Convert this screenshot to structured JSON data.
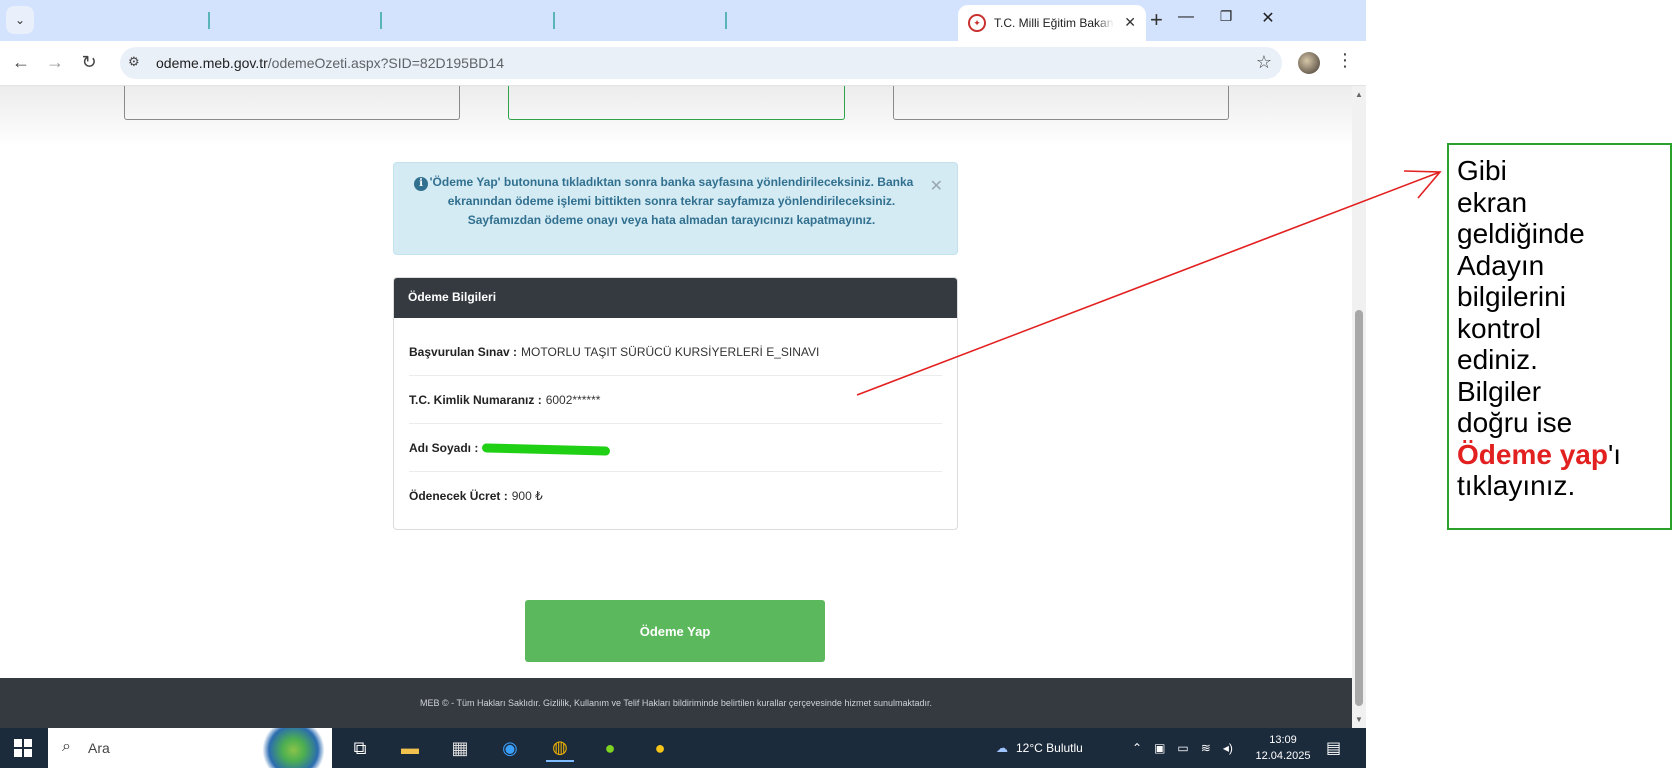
{
  "browser": {
    "tab": {
      "title": "T.C. Milli Eğitim Bakanlığı"
    },
    "url": {
      "host": "odeme.meb.gov.tr",
      "path": "/odemeOzeti.aspx?SID=82D195BD14"
    }
  },
  "page": {
    "info_alert": "'Ödeme Yap' butonuna tıkladıktan sonra banka sayfasına yönlendirileceksiniz. Banka ekranından ödeme işlemi bittikten sonra tekrar sayfamıza yönlendirileceksiniz. Sayfamızdan ödeme onayı veya hata almadan tarayıcınızı kapatmayınız.",
    "panel": {
      "title": "Ödeme Bilgileri",
      "rows": [
        {
          "label": "Başvurulan Sınav :",
          "value": "MOTORLU TAŞIT SÜRÜCÜ KURSİYERLERİ E_SINAVI"
        },
        {
          "label": "T.C. Kimlik Numaranız :",
          "value": "6002******"
        },
        {
          "label": "Adı Soyadı :",
          "value": ""
        },
        {
          "label": "Ödenecek Ücret :",
          "value": "900 ₺"
        }
      ]
    },
    "pay_button": "Ödeme Yap",
    "footer": "MEB © - Tüm Hakları Saklıdır. Gizlilik, Kullanım ve Telif Hakları bildiriminde belirtilen kurallar çerçevesinde hizmet sunulmaktadır."
  },
  "taskbar": {
    "search_placeholder": "Ara",
    "weather": "12°C  Bulutlu",
    "time": "13:09",
    "date": "12.04.2025"
  },
  "annotation": {
    "lines": [
      "Gibi",
      "ekran",
      "geldiğinde",
      "Adayın",
      "bilgilerini",
      "kontrol",
      "ediniz.",
      "Bilgiler",
      "doğru ise"
    ],
    "highlight": "Ödeme yap",
    "highlight_suffix": "'ı",
    "last_line": "tıklayınız.",
    "colors": {
      "box": "#2aa12a",
      "highlight": "#e22020",
      "arrow": "#e22020"
    }
  }
}
